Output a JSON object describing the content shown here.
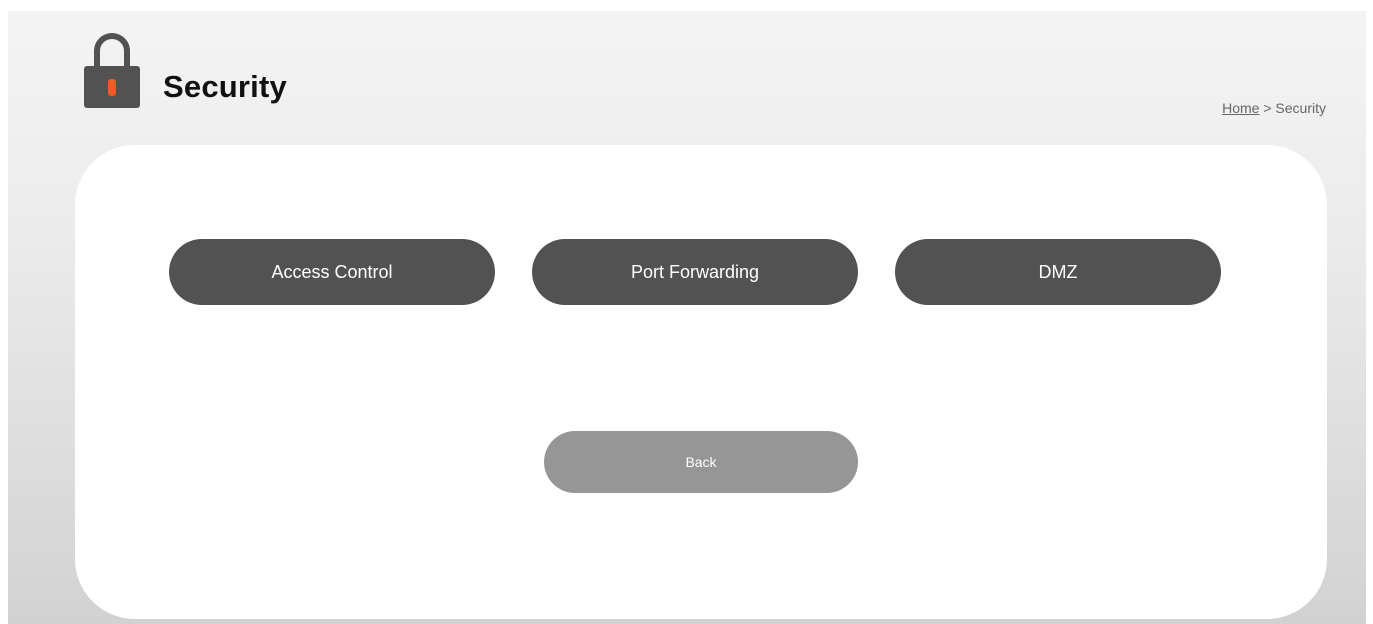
{
  "header": {
    "icon": "lock-icon",
    "title": "Security"
  },
  "breadcrumb": {
    "home_label": "Home",
    "separator": " > ",
    "current": "Security"
  },
  "menu": {
    "buttons": [
      {
        "label": "Access Control"
      },
      {
        "label": "Port Forwarding"
      },
      {
        "label": "DMZ"
      }
    ]
  },
  "actions": {
    "back_label": "Back"
  },
  "colors": {
    "button_primary": "#525252",
    "button_secondary": "#969696",
    "lock_body": "#525252",
    "lock_keyhole": "#f05a24"
  }
}
